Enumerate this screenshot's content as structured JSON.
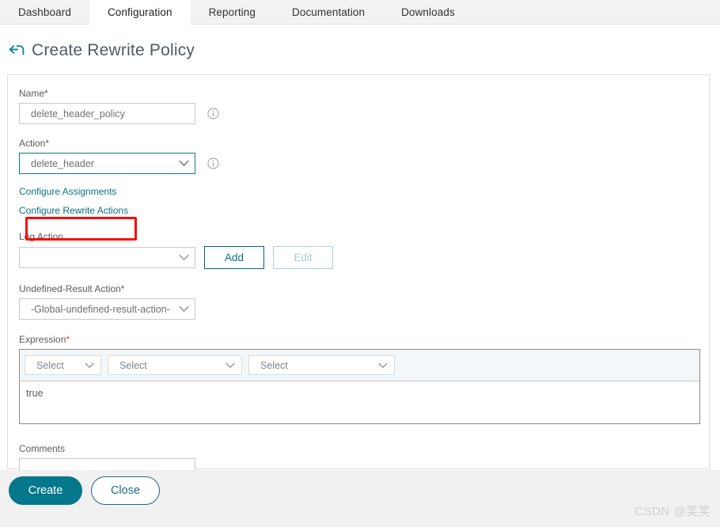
{
  "topnav": {
    "tabs": [
      {
        "label": "Dashboard",
        "active": false
      },
      {
        "label": "Configuration",
        "active": true
      },
      {
        "label": "Reporting",
        "active": false
      },
      {
        "label": "Documentation",
        "active": false
      },
      {
        "label": "Downloads",
        "active": false
      }
    ]
  },
  "header": {
    "back_icon": "back-arrow-icon",
    "title": "Create Rewrite Policy"
  },
  "form": {
    "name": {
      "label": "Name",
      "required_mark": "*",
      "value": "delete_header_policy",
      "placeholder": "",
      "info_icon": "info-icon"
    },
    "action": {
      "label": "Action",
      "required_mark": "*",
      "value": "delete_header",
      "info_icon": "info-icon",
      "chevron_icon": "chevron-down-icon"
    },
    "links": [
      {
        "label": "Configure Assignments"
      },
      {
        "label": "Configure Rewrite Actions"
      }
    ],
    "log_action": {
      "label": "Log Action",
      "value": "",
      "chevron_icon": "chevron-down-icon",
      "add_label": "Add",
      "edit_label": "Edit"
    },
    "undefined_result_action": {
      "label": "Undefined-Result Action",
      "required_mark": "*",
      "value": "-Global-undefined-result-action-",
      "chevron_icon": "chevron-down-icon"
    },
    "expression": {
      "label": "Expression",
      "required_mark": "*",
      "selects": [
        {
          "value": "Select",
          "chevron_icon": "chevron-down-icon"
        },
        {
          "value": "Select",
          "chevron_icon": "chevron-down-icon"
        },
        {
          "value": "Select",
          "chevron_icon": "chevron-down-icon"
        }
      ],
      "text": "true"
    },
    "comments": {
      "label": "Comments",
      "value": "",
      "placeholder": ""
    }
  },
  "footer": {
    "create_label": "Create",
    "close_label": "Close"
  },
  "watermark": {
    "text": "CSDN @笑笑"
  },
  "colors": {
    "teal": "#04778c",
    "link": "#0a7184",
    "annotation_red": "#fb0a06",
    "nav_bg": "#f2f2f2",
    "expr_bar_bg": "#f3f7fa"
  }
}
